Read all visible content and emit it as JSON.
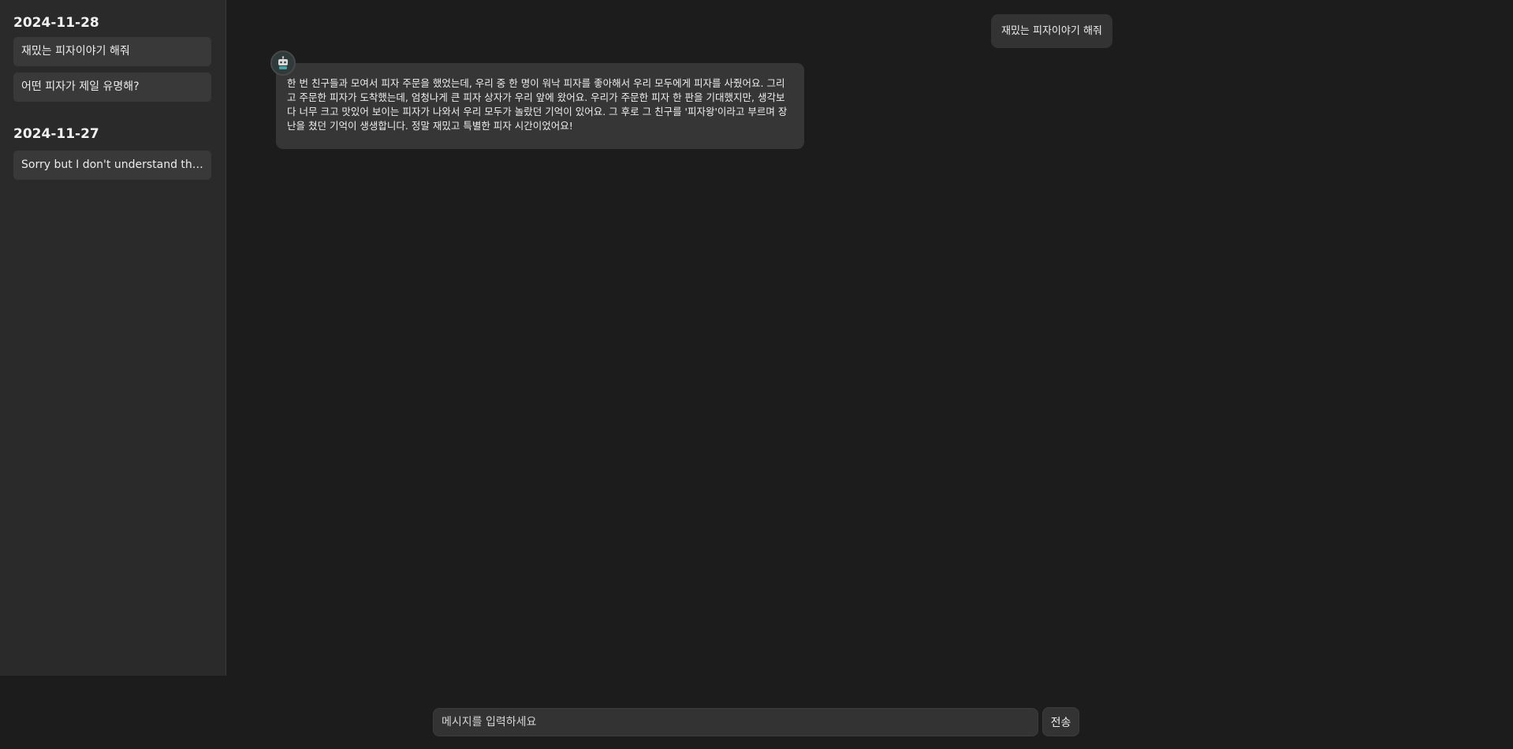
{
  "sidebar": {
    "groups": [
      {
        "date": "2024-11-28",
        "items": [
          "재밌는 피자이야기 해줘",
          "어떤 피자가 제일 유명해?"
        ]
      },
      {
        "date": "2024-11-27",
        "items": [
          "Sorry but I don't understand the …"
        ]
      }
    ]
  },
  "chat": {
    "user_message": "재밌는 피자이야기 해줘",
    "bot_message": "한 번 친구들과 모여서 피자 주문을 했었는데, 우리 중 한 명이 워낙 피자를 좋아해서 우리 모두에게 피자를 사줬어요. 그리고 주문한 피자가 도착했는데, 엄청나게 큰 피자 상자가 우리 앞에 왔어요. 우리가 주문한 피자 한 판을 기대했지만, 생각보다 너무 크고 맛있어 보이는 피자가 나와서 우리 모두가 놀랐던 기억이 있어요. 그 후로 그 친구를 '피자왕'이라고 부르며 장난을 쳤던 기억이 생생합니다. 정말 재밌고 특별한 피자 시간이었어요!"
  },
  "composer": {
    "placeholder": "메시지를 입력하세요",
    "send_label": "전송"
  },
  "icons": {
    "bot_avatar": "robot-icon"
  }
}
